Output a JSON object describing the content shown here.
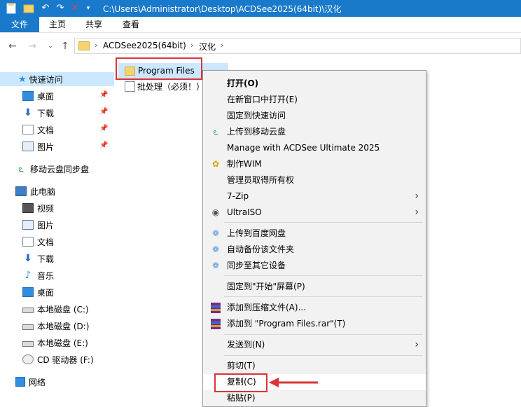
{
  "window": {
    "title": "C:\\Users\\Administrator\\Desktop\\ACDSee2025(64bit)\\汉化",
    "quick_access_icons": [
      "file-icon",
      "undo-icon",
      "redo-icon",
      "delete-icon",
      "customize-dropdown-icon"
    ]
  },
  "ribbon": {
    "tabs": [
      "文件",
      "主页",
      "共享",
      "查看"
    ]
  },
  "address": {
    "crumbs": [
      "ACDSee2025(64bit)",
      "汉化"
    ],
    "separator": "›"
  },
  "nav": {
    "quick_access": "快速访问",
    "quick_items": [
      "桌面",
      "下载",
      "文档",
      "图片"
    ],
    "cloud": "移动云盘同步盘",
    "this_pc": "此电脑",
    "pc_items": [
      "视频",
      "图片",
      "文档",
      "下载",
      "音乐",
      "桌面",
      "本地磁盘 (C:)",
      "本地磁盘 (D:)",
      "本地磁盘 (E:)",
      "CD 驱动器 (F:)"
    ],
    "network": "网络"
  },
  "files": [
    {
      "name": "Program Files",
      "selected": true
    },
    {
      "name": "批处理（必须！）",
      "selected": false
    }
  ],
  "context_menu": {
    "items": [
      {
        "label": "打开(O)",
        "bold": true
      },
      {
        "label": "在新窗口中打开(E)"
      },
      {
        "label": "固定到快速访问"
      },
      {
        "label": "上传到移动云盘",
        "icon": "cloud-icon"
      },
      {
        "label": "Manage with ACDSee Ultimate 2025"
      },
      {
        "label": "制作WIM",
        "icon": "wim-icon"
      },
      {
        "label": "管理员取得所有权"
      },
      {
        "label": "7-Zip",
        "submenu": true
      },
      {
        "label": "UltraISO",
        "icon": "ultraiso-icon",
        "submenu": true
      },
      {
        "label": "上传到百度网盘",
        "icon": "baidu-icon"
      },
      {
        "label": "自动备份该文件夹",
        "icon": "baidu-icon"
      },
      {
        "label": "同步至其它设备",
        "icon": "baidu-icon"
      },
      {
        "label": "固定到\"开始\"屏幕(P)"
      },
      {
        "label": "添加到压缩文件(A)...",
        "icon": "winrar-icon"
      },
      {
        "label": "添加到 \"Program Files.rar\"(T)",
        "icon": "winrar-icon"
      },
      {
        "label": "发送到(N)",
        "submenu": true
      },
      {
        "label": "剪切(T)"
      },
      {
        "label": "复制(C)",
        "highlighted": true
      },
      {
        "label": "粘贴(P)"
      }
    ],
    "submenu_arrow": "›"
  },
  "colors": {
    "titlebar": "#1979ca",
    "selection": "#cce8ff",
    "annotation_red": "#d9343b",
    "menu_bg": "#f2f2f2"
  }
}
